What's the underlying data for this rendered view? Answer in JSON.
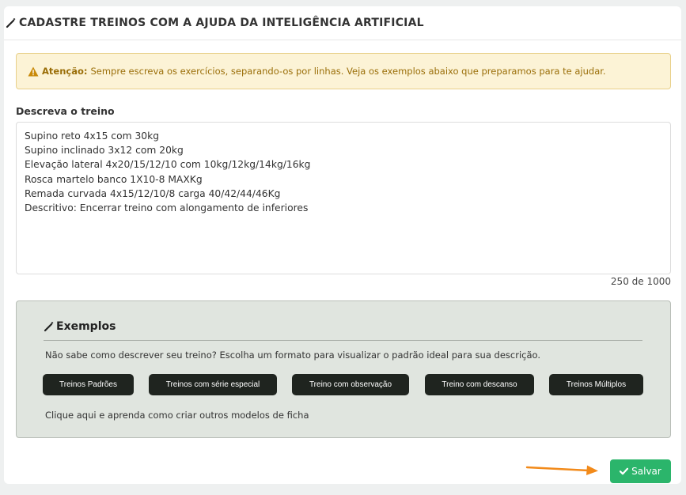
{
  "header": {
    "title": "CADASTRE TREINOS COM A AJUDA DA INTELIGÊNCIA ARTIFICIAL"
  },
  "alert": {
    "strong": "Atenção:",
    "text": "Sempre escreva os exercícios, separando-os por linhas. Veja os exemplos abaixo que preparamos para te ajudar."
  },
  "form": {
    "label": "Descreva o treino",
    "value": "Supino reto 4x15 com 30kg\nSupino inclinado 3x12 com 20kg\nElevação lateral 4x20/15/12/10 com 10kg/12kg/14kg/16kg\nRosca martelo banco 1X10-8 MAXKg\nRemada curvada 4x15/12/10/8 carga 40/42/44/46Kg\nDescritivo: Encerrar treino com alongamento de inferiores",
    "counter": "250 de 1000"
  },
  "examples": {
    "title": "Exemplos",
    "description": "Não sabe como descrever seu treino? Escolha um formato para visualizar o padrão ideal para sua descrição.",
    "buttons": [
      "Treinos Padrões",
      "Treinos com série especial",
      "Treino com observação",
      "Treino com descanso",
      "Treinos Múltiplos"
    ],
    "link": "Clique aqui e aprenda como criar outros modelos de ficha"
  },
  "footer": {
    "save_label": "Salvar"
  },
  "colors": {
    "save": "#2bb56b",
    "arrow": "#f28a1a",
    "alert_text": "#9a6e08",
    "example_button": "#1f241f"
  }
}
